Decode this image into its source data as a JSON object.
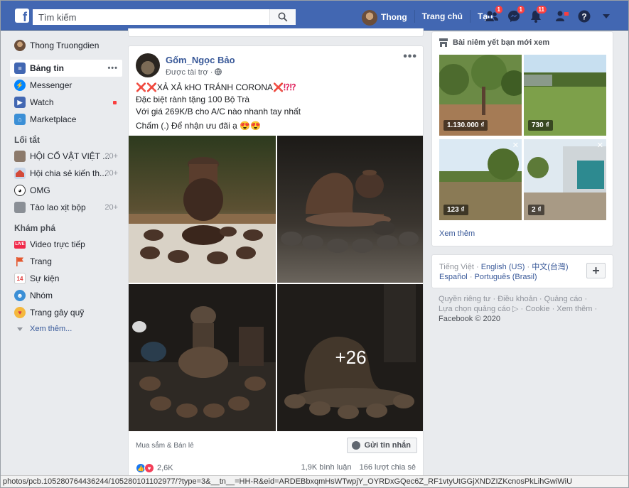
{
  "topbar": {
    "logo": "f",
    "search_placeholder": "Tìm kiếm",
    "profile_name": "Thong",
    "home_label": "Trang chủ",
    "create_label": "Tạo",
    "friend_requests_count": "1",
    "messages_count": "1",
    "notifications_count": "11"
  },
  "sidebar": {
    "profile_name": "Thong Truongdien",
    "items": [
      {
        "label": "Bảng tin"
      },
      {
        "label": "Messenger"
      },
      {
        "label": "Watch"
      },
      {
        "label": "Marketplace"
      }
    ],
    "shortcuts_heading": "Lối tắt",
    "shortcuts": [
      {
        "label": "HỘI CỔ VẬT VIỆT ...",
        "count": "20+"
      },
      {
        "label": "Hội chia sẻ kiến th...",
        "count": "20+"
      },
      {
        "label": "OMG",
        "count": ""
      },
      {
        "label": "Tào lao xịt bộp",
        "count": "20+"
      }
    ],
    "explore_heading": "Khám phá",
    "explore": [
      {
        "label": "Video trực tiếp",
        "icon": "live-icon"
      },
      {
        "label": "Trang",
        "icon": "flag-icon"
      },
      {
        "label": "Sự kiện",
        "icon": "calendar-icon"
      },
      {
        "label": "Nhóm",
        "icon": "groups-icon"
      },
      {
        "label": "Trang gây quỹ",
        "icon": "fundraiser-icon"
      }
    ],
    "see_more": "Xem thêm..."
  },
  "post": {
    "page_name": "Gốm_Ngọc Bảo",
    "sponsored": "Được tài trợ",
    "line1": "XẢ XẢ kHO TRÁNH CORONA",
    "line2": "Đặc biệt rành tặng 100 Bộ Trà",
    "line3": "Với giá 269K/B cho A/C nào nhanh tay nhất",
    "line4": "Chấm (.) Để nhận ưu đãi ạ",
    "more_photos": "+26",
    "category": "Mua sắm & Bán lẻ",
    "message_button": "Gửi tin nhắn",
    "reactions_count": "2,6K",
    "comments": "1,9K bình luận",
    "shares": "166 lượt chia sẻ"
  },
  "marketplace": {
    "title": "Bài niêm yết bạn mới xem",
    "listings": [
      {
        "price": "1.130.000 ₫"
      },
      {
        "price": "730 ₫"
      },
      {
        "price": "123 ₫"
      },
      {
        "price": "2 ₫"
      }
    ],
    "see_more": "Xem thêm"
  },
  "languages": {
    "current": "Tiếng Việt",
    "options": [
      "English (US)",
      "中文(台灣)",
      "Español",
      "Português (Brasil)"
    ],
    "add": "+"
  },
  "footer": {
    "links": [
      "Quyền riêng tư",
      "Điều khoản",
      "Quảng cáo",
      "Lựa chọn quảng cáo",
      "Cookie",
      "Xem thêm"
    ],
    "copyright": "Facebook © 2020"
  },
  "statusbar": {
    "url": "photos/pcb.105280764436244/105280101102977/?type=3&__tn__=HH-R&eid=ARDEBbxqmHsWTwpjY_OYRDxGQec6Z_RF1vtyUtGGjXNDZIZKcnosPkLihGwiWiU"
  },
  "colors": {
    "brand": "#4267b2",
    "link": "#385898",
    "badge": "#fa3e3e",
    "background": "#e9ebee"
  }
}
